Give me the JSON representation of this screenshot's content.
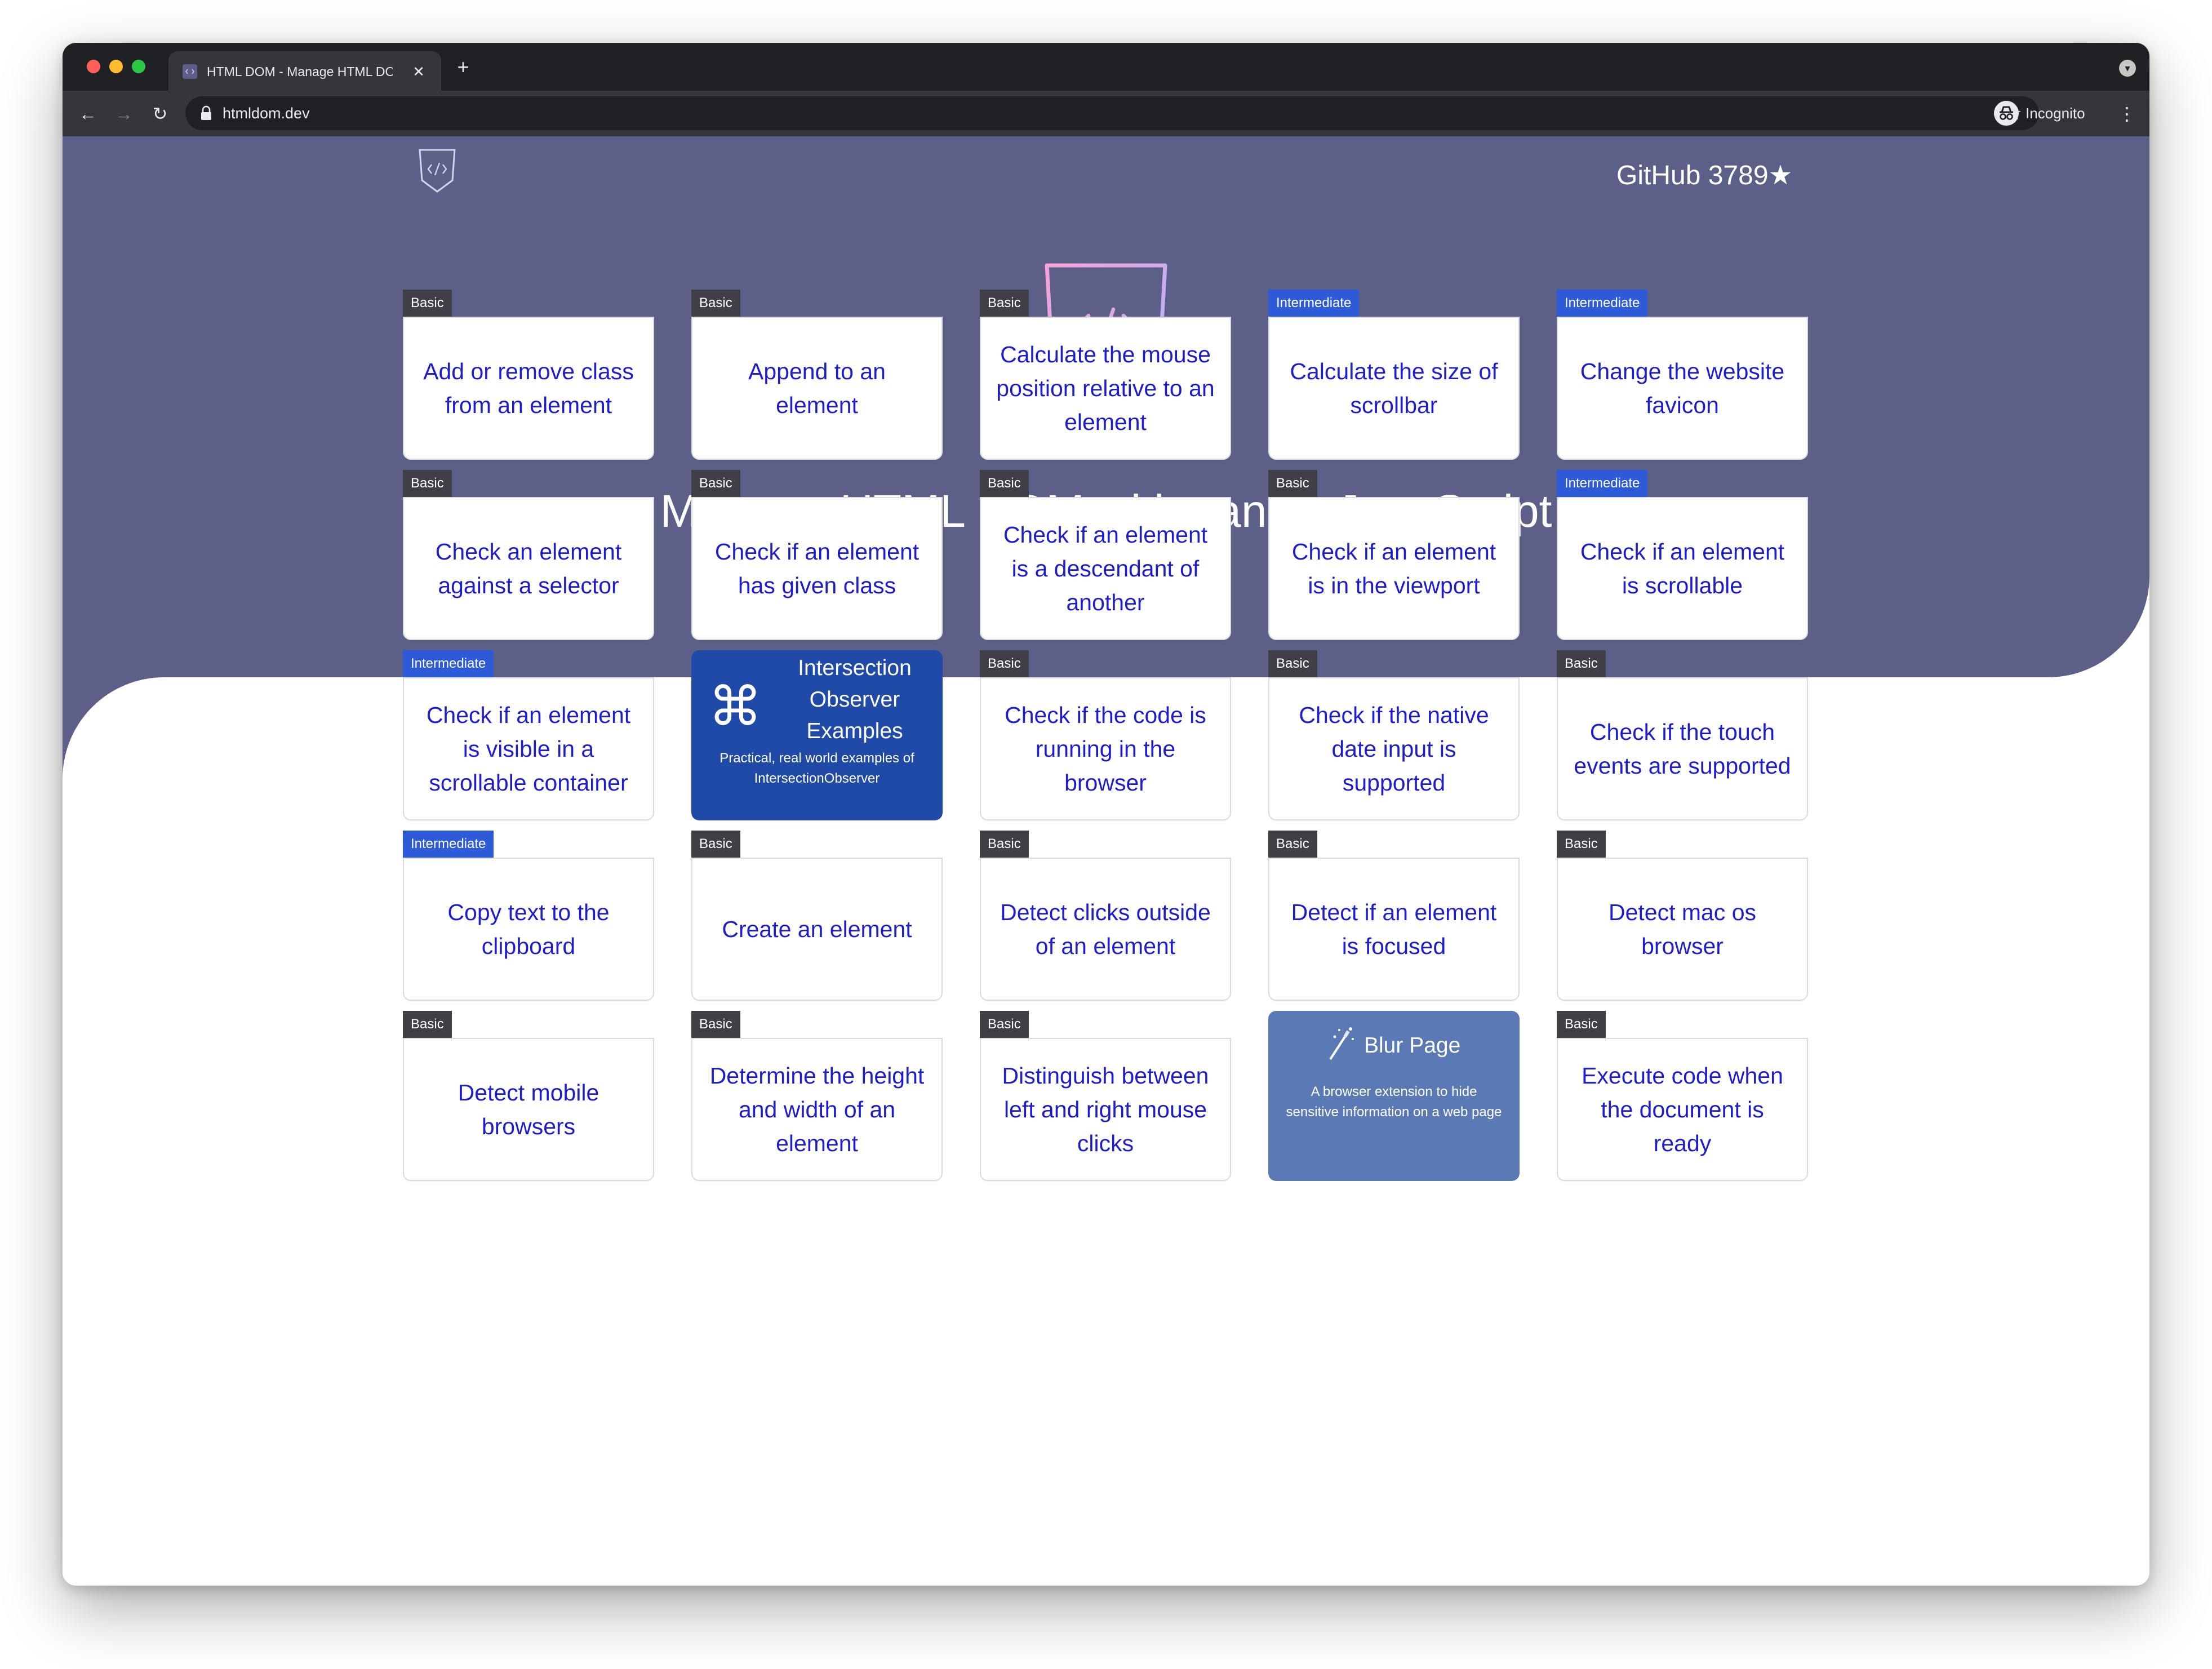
{
  "browser": {
    "tab_title": "HTML DOM - Manage HTML DOM with vanilla JavaScript",
    "tab_close": "✕",
    "new_tab": "+",
    "url": "htmldom.dev",
    "mode_label": "Incognito",
    "nav": {
      "back": "←",
      "forward": "→",
      "reload": "↻"
    },
    "bookmark_star": "☆",
    "menu": "⋮",
    "tab_search": "▾"
  },
  "header": {
    "github_label": "GitHub",
    "github_stars": "3789",
    "github_star_icon": "★",
    "title": "Manage HTML DOM with vanilla JavaScript",
    "logo_gradient": [
      "#f6a3d8",
      "#a9b3ff"
    ]
  },
  "cards": [
    {
      "level": "Basic",
      "title": "Add or remove class from an element"
    },
    {
      "level": "Basic",
      "title": "Append to an element"
    },
    {
      "level": "Basic",
      "title": "Calculate the mouse position relative to an element"
    },
    {
      "level": "Intermediate",
      "title": "Calculate the size of scrollbar"
    },
    {
      "level": "Intermediate",
      "title": "Change the website favicon"
    },
    {
      "level": "Basic",
      "title": "Check an element against a selector"
    },
    {
      "level": "Basic",
      "title": "Check if an element has given class"
    },
    {
      "level": "Basic",
      "title": "Check if an element is a descendant of another"
    },
    {
      "level": "Basic",
      "title": "Check if an element is in the viewport"
    },
    {
      "level": "Intermediate",
      "title": "Check if an element is scrollable"
    },
    {
      "level": "Intermediate",
      "title": "Check if an element is visible in a scrollable container"
    },
    {
      "ad": true,
      "title": "Intersection Observer Examples",
      "description": "Practical, real world examples of IntersectionObserver",
      "icon": "⌘",
      "style": "dark"
    },
    {
      "level": "Basic",
      "title": "Check if the code is running in the browser"
    },
    {
      "level": "Basic",
      "title": "Check if the native date input is supported"
    },
    {
      "level": "Basic",
      "title": "Check if the touch events are supported"
    },
    {
      "level": "Intermediate",
      "title": "Copy text to the clipboard"
    },
    {
      "level": "Basic",
      "title": "Create an element"
    },
    {
      "level": "Basic",
      "title": "Detect clicks outside of an element"
    },
    {
      "level": "Basic",
      "title": "Detect if an element is focused"
    },
    {
      "level": "Basic",
      "title": "Detect mac os browser"
    },
    {
      "level": "Basic",
      "title": "Detect mobile browsers"
    },
    {
      "level": "Basic",
      "title": "Determine the height and width of an element"
    },
    {
      "level": "Basic",
      "title": "Distinguish between left and right mouse clicks"
    },
    {
      "ad": true,
      "title": "Blur Page",
      "description": "A browser extension to hide sensitive information on a web page",
      "icon": "magic-wand-icon",
      "style": "light"
    },
    {
      "level": "Basic",
      "title": "Execute code when the document is ready"
    }
  ],
  "colors": {
    "hero": "#5c5f87",
    "link": "#1d1dcc",
    "badge_basic": "#3f4045",
    "badge_intermediate": "#2d5bd8"
  }
}
